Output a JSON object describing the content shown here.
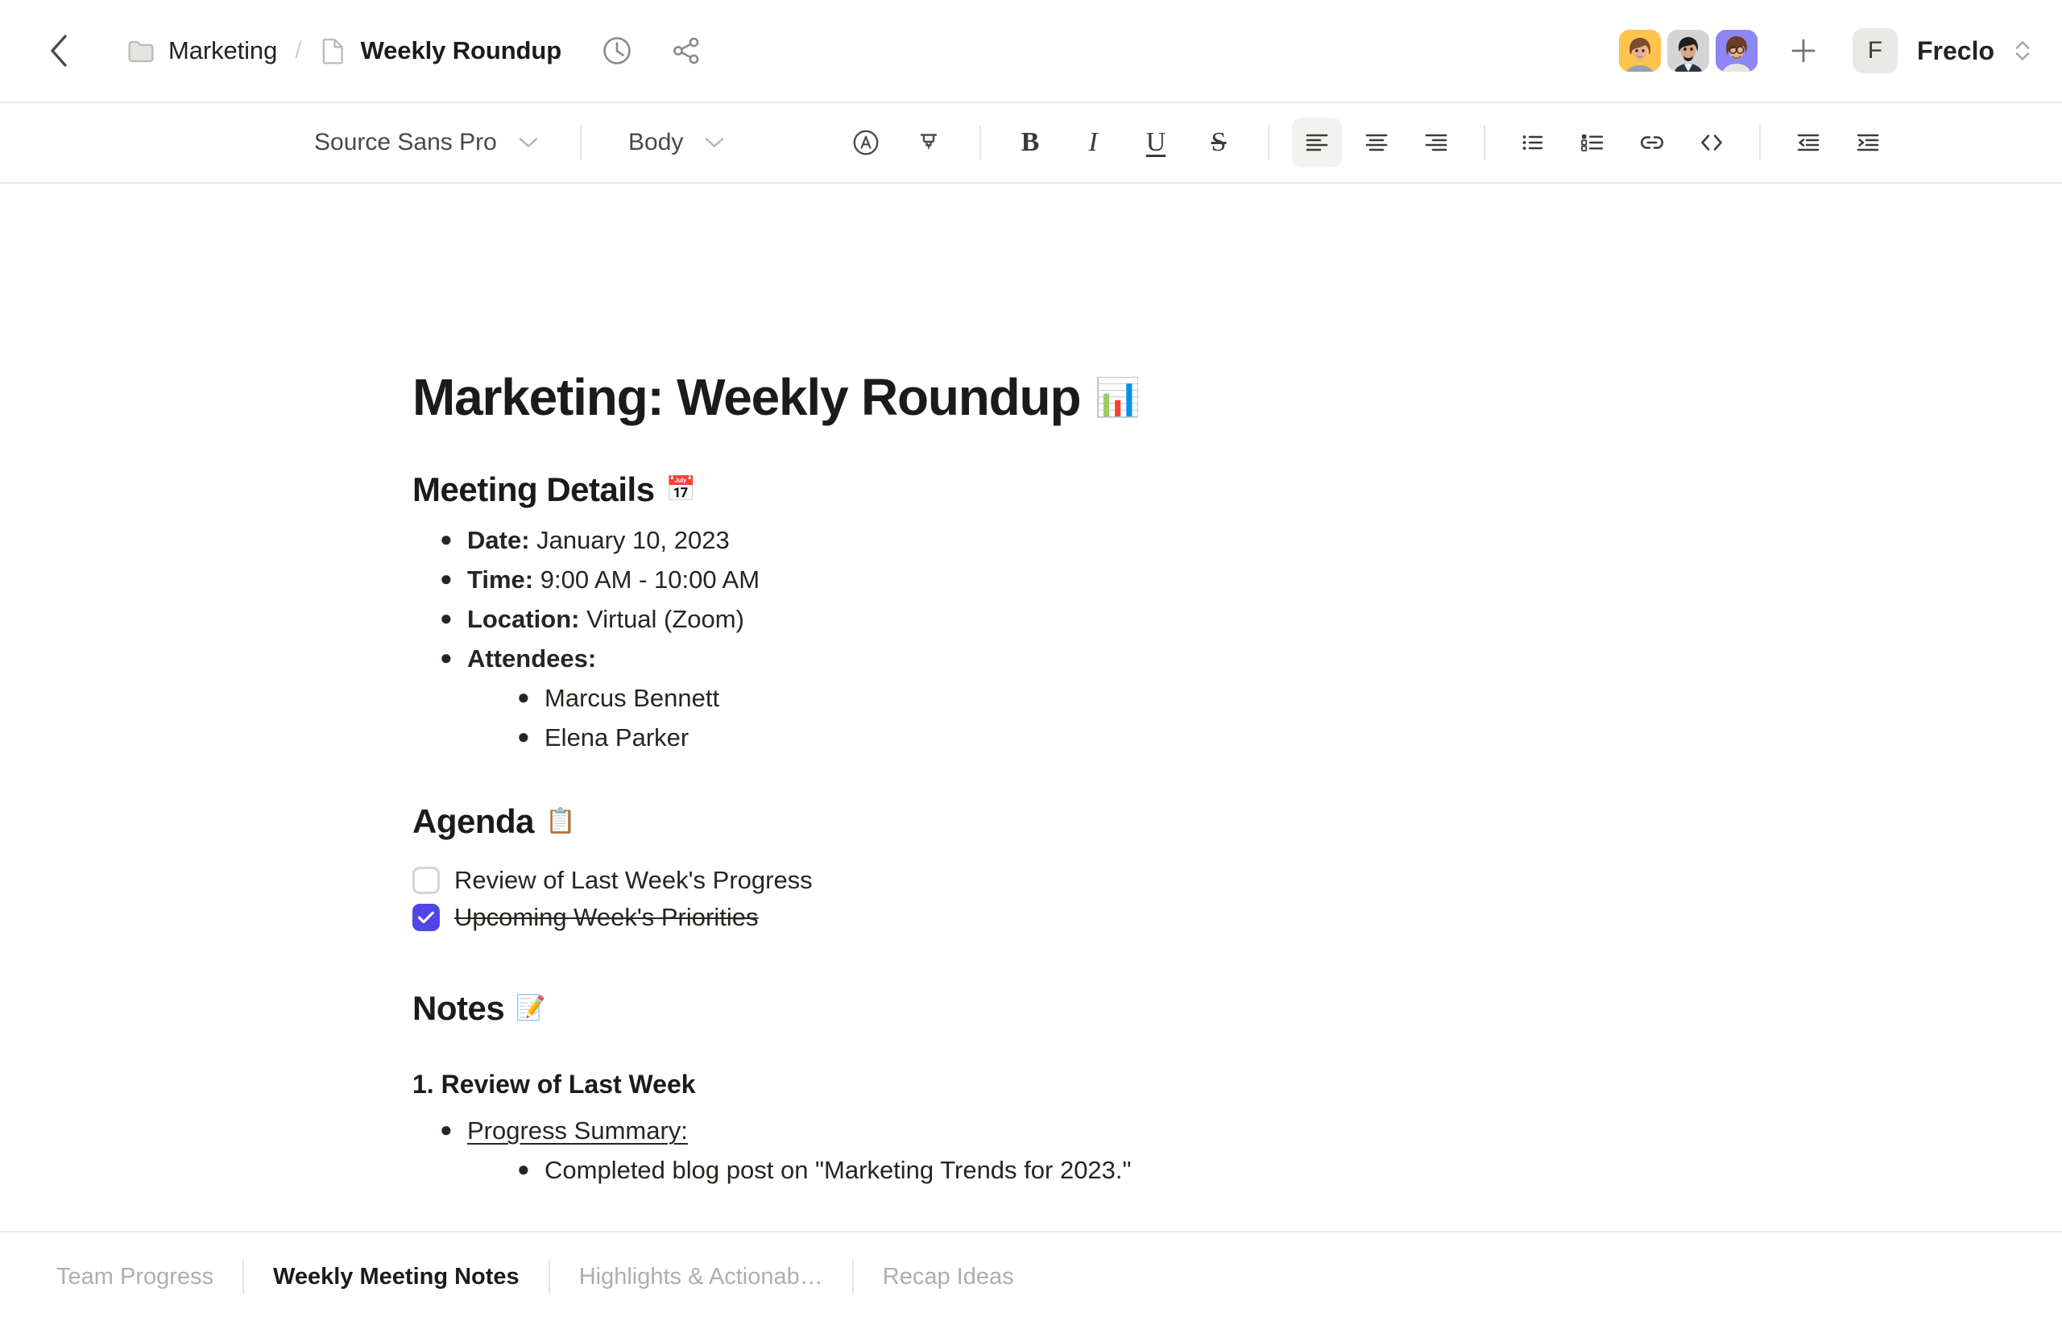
{
  "header": {
    "back_icon": "chevron-left-icon",
    "breadcrumb": {
      "folder_icon": "folder-icon",
      "folder_label": "Marketing",
      "separator": "/",
      "doc_icon": "document-icon",
      "doc_label": "Weekly Roundup"
    },
    "actions": [
      {
        "icon": "history-clock-icon",
        "label": "Version history"
      },
      {
        "icon": "share-icon",
        "label": "Share"
      }
    ],
    "collaborators": [
      {
        "name": "collaborator-1",
        "bg": "#ffc44d"
      },
      {
        "name": "collaborator-2",
        "bg": "#d4d4d6"
      },
      {
        "name": "collaborator-3",
        "bg": "#8d86f5"
      }
    ],
    "add_label": "+",
    "user": {
      "initial": "F",
      "name": "Freclo",
      "chevron_icon": "chevron-up-down-icon"
    }
  },
  "toolbar": {
    "font_family": "Source Sans Pro",
    "text_style": "Body",
    "buttons": [
      {
        "name": "text-color-icon",
        "label": "Text color"
      },
      {
        "name": "highlighter-icon",
        "label": "Highlight"
      },
      {
        "name": "bold-icon",
        "label": "B"
      },
      {
        "name": "italic-icon",
        "label": "I"
      },
      {
        "name": "underline-icon",
        "label": "U"
      },
      {
        "name": "strikethrough-icon",
        "label": "S"
      },
      {
        "name": "align-left-icon",
        "label": "Align left"
      },
      {
        "name": "align-center-icon",
        "label": "Align center"
      },
      {
        "name": "align-right-icon",
        "label": "Align right"
      },
      {
        "name": "bullet-list-icon",
        "label": "Bulleted list"
      },
      {
        "name": "numbered-list-icon",
        "label": "Numbered list"
      },
      {
        "name": "link-icon",
        "label": "Link"
      },
      {
        "name": "code-icon",
        "label": "Code"
      },
      {
        "name": "outdent-icon",
        "label": "Decrease indent"
      },
      {
        "name": "indent-icon",
        "label": "Increase indent"
      }
    ],
    "active_button": "align-left-icon"
  },
  "document": {
    "title": "Marketing: Weekly Roundup",
    "title_emoji": "📊",
    "sections": {
      "meeting_details": {
        "heading": "Meeting Details",
        "emoji": "📅",
        "items": [
          {
            "label": "Date:",
            "value": "January 10, 2023"
          },
          {
            "label": "Time:",
            "value": "9:00 AM - 10:00 AM"
          },
          {
            "label": "Location:",
            "value": "Virtual (Zoom)"
          },
          {
            "label": "Attendees:",
            "value": ""
          }
        ],
        "attendees": [
          "Marcus Bennett",
          "Elena Parker"
        ]
      },
      "agenda": {
        "heading": "Agenda",
        "emoji": "📋",
        "items": [
          {
            "text": "Review of Last Week's Progress",
            "checked": false
          },
          {
            "text": "Upcoming Week's Priorities",
            "checked": true
          }
        ]
      },
      "notes": {
        "heading": "Notes",
        "emoji": "📝",
        "subheading": "1. Review of Last Week",
        "bullet": "Progress Summary:",
        "sub_bullet": "Completed blog post on \"Marketing Trends for 2023.\""
      }
    }
  },
  "tabbar": {
    "tabs": [
      {
        "label": "Team Progress",
        "active": false
      },
      {
        "label": "Weekly Meeting Notes",
        "active": true
      },
      {
        "label": "Highlights & Actionab…",
        "active": false
      },
      {
        "label": "Recap Ideas",
        "active": false
      }
    ]
  },
  "colors": {
    "accent": "#5046e5",
    "text": "#1b1b19",
    "muted": "#b0aeaa",
    "border": "#e8e8e8"
  }
}
